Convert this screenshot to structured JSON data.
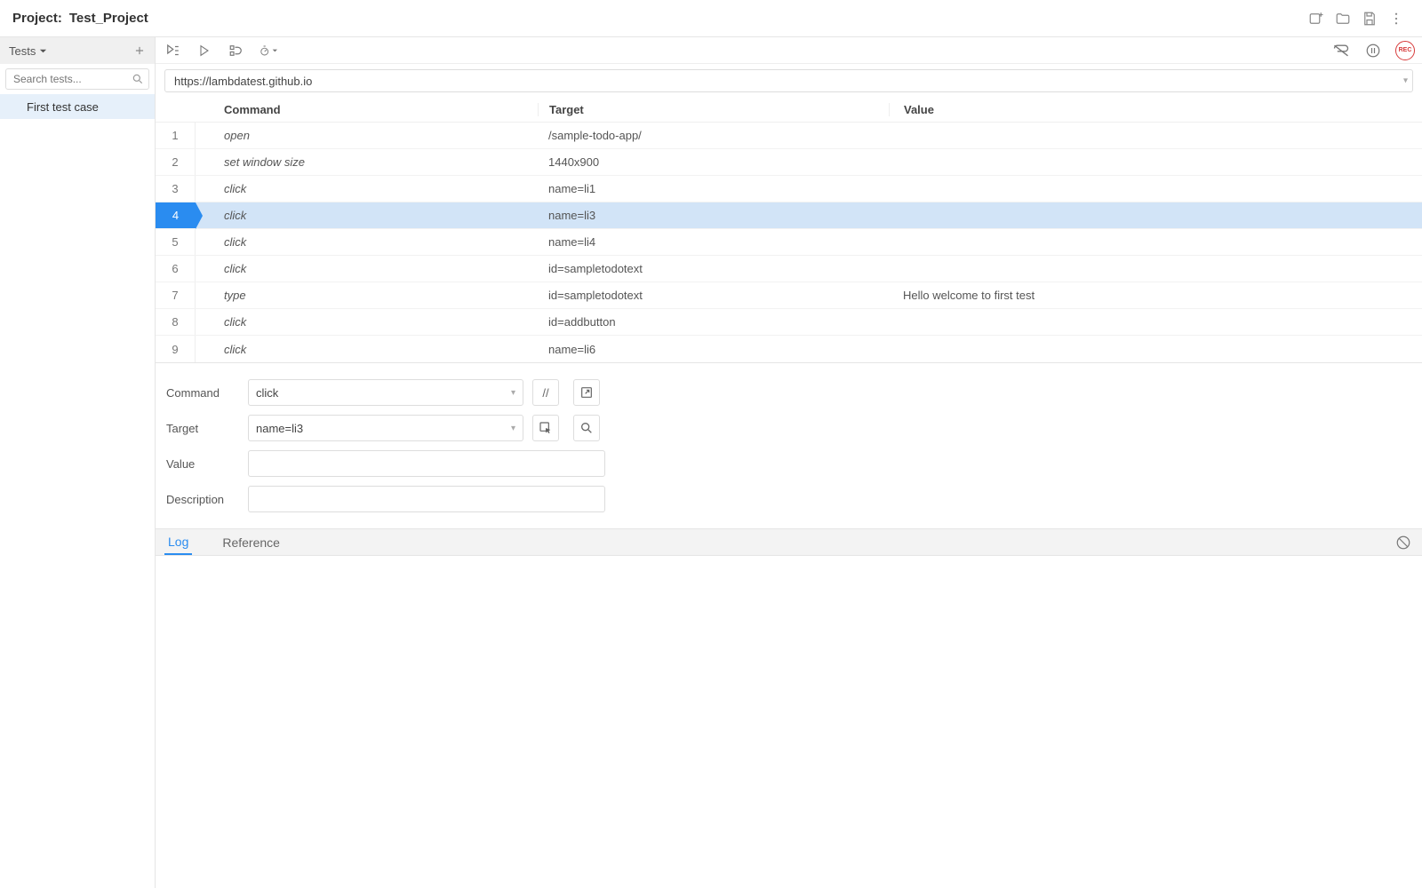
{
  "project": {
    "label": "Project:",
    "name": "Test_Project"
  },
  "sidebar": {
    "title": "Tests",
    "search_placeholder": "Search tests...",
    "tests": [
      {
        "name": "First test case"
      }
    ]
  },
  "url": "https://lambdatest.github.io",
  "table": {
    "headers": {
      "command": "Command",
      "target": "Target",
      "value": "Value"
    },
    "selected_index": 3,
    "rows": [
      {
        "n": "1",
        "command": "open",
        "target": "/sample-todo-app/",
        "value": ""
      },
      {
        "n": "2",
        "command": "set window size",
        "target": "1440x900",
        "value": ""
      },
      {
        "n": "3",
        "command": "click",
        "target": "name=li1",
        "value": ""
      },
      {
        "n": "4",
        "command": "click",
        "target": "name=li3",
        "value": ""
      },
      {
        "n": "5",
        "command": "click",
        "target": "name=li4",
        "value": ""
      },
      {
        "n": "6",
        "command": "click",
        "target": "id=sampletodotext",
        "value": ""
      },
      {
        "n": "7",
        "command": "type",
        "target": "id=sampletodotext",
        "value": "Hello welcome to first test"
      },
      {
        "n": "8",
        "command": "click",
        "target": "id=addbutton",
        "value": ""
      },
      {
        "n": "9",
        "command": "click",
        "target": "name=li6",
        "value": ""
      }
    ]
  },
  "form": {
    "labels": {
      "command": "Command",
      "target": "Target",
      "value": "Value",
      "description": "Description"
    },
    "command": "click",
    "target": "name=li3",
    "value": "",
    "description": ""
  },
  "tabs": {
    "log": "Log",
    "reference": "Reference"
  },
  "rec_label": "REC",
  "comment_symbol": "//"
}
